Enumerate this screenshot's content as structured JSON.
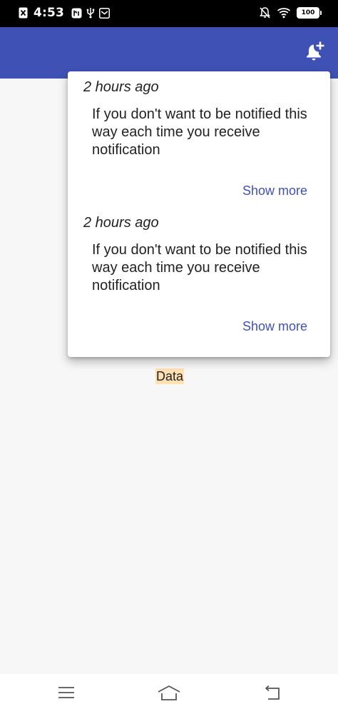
{
  "status_bar": {
    "time": "4:53",
    "battery": "100",
    "icons": [
      "x-app-icon",
      "app-notification-icon",
      "usb-icon",
      "mail-icon",
      "mute-icon",
      "wifi-icon",
      "battery-icon"
    ]
  },
  "app_bar": {
    "color": "#3f51b5",
    "action_icon": "add-alert-icon"
  },
  "notifications": [
    {
      "time": "2 hours ago",
      "message": "If you don't want to be notified this way each time you receive notification",
      "action": "Show more"
    },
    {
      "time": "2 hours ago",
      "message": "If you don't want to be notified this way each time you receive notification",
      "action": "Show more"
    }
  ],
  "main": {
    "label": "Data",
    "label_highlight": "#ffe0b2"
  },
  "nav_bar": {
    "icons": [
      "menu-icon",
      "home-icon",
      "back-icon"
    ]
  },
  "colors": {
    "accent": "#3f51b5",
    "background": "#f7f7f7"
  }
}
